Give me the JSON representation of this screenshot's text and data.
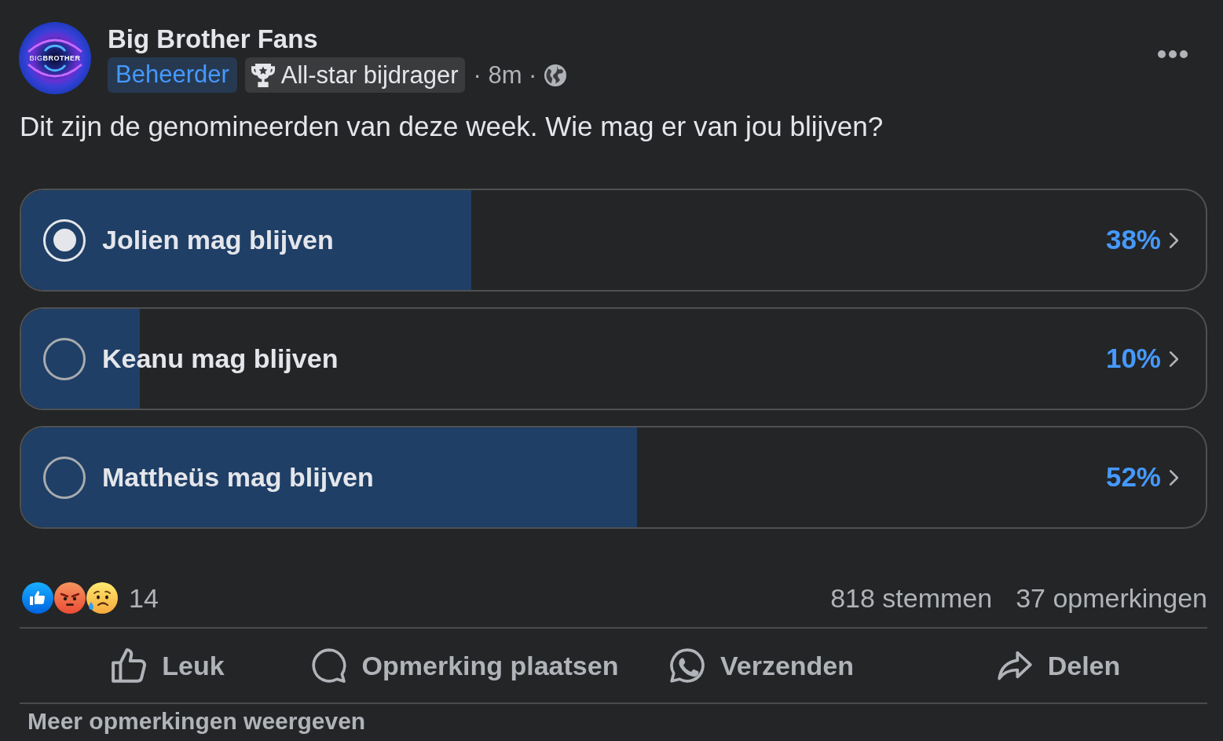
{
  "post": {
    "author": {
      "name": "Big Brother Fans",
      "logo_text": "BIG**BROTHER**"
    },
    "badges": [
      {
        "kind": "role",
        "label": "Beheerder"
      },
      {
        "kind": "award",
        "label": "All-star bijdrager"
      }
    ],
    "meta": "· 8m ·",
    "text": "Dit zijn de genomineerden van deze week. Wie mag er van jou blijven?"
  },
  "poll": {
    "options": [
      {
        "label": "Jolien mag blijven",
        "selected": true,
        "level": 0.38,
        "percent": "38%"
      },
      {
        "label": "Keanu mag blijven",
        "selected": false,
        "level": 0.1,
        "percent": "10%"
      },
      {
        "label": "Mattheüs mag blijven",
        "selected": false,
        "level": 0.52,
        "percent": "52%"
      }
    ]
  },
  "reactions": {
    "emojis": [
      {
        "kind": "like"
      },
      {
        "kind": "angry"
      },
      {
        "kind": "sad"
      }
    ],
    "count": "14"
  },
  "stats": {
    "votes": "818 stemmen",
    "comments": "37 opmerkingen"
  },
  "actions": [
    {
      "kind": "like",
      "label": "Leuk"
    },
    {
      "kind": "comment",
      "label": "Opmerking plaatsen"
    },
    {
      "kind": "send",
      "label": "Verzenden"
    },
    {
      "kind": "share",
      "label": "Delen"
    }
  ],
  "more_comments": "Meer opmerkingen weergeven"
}
